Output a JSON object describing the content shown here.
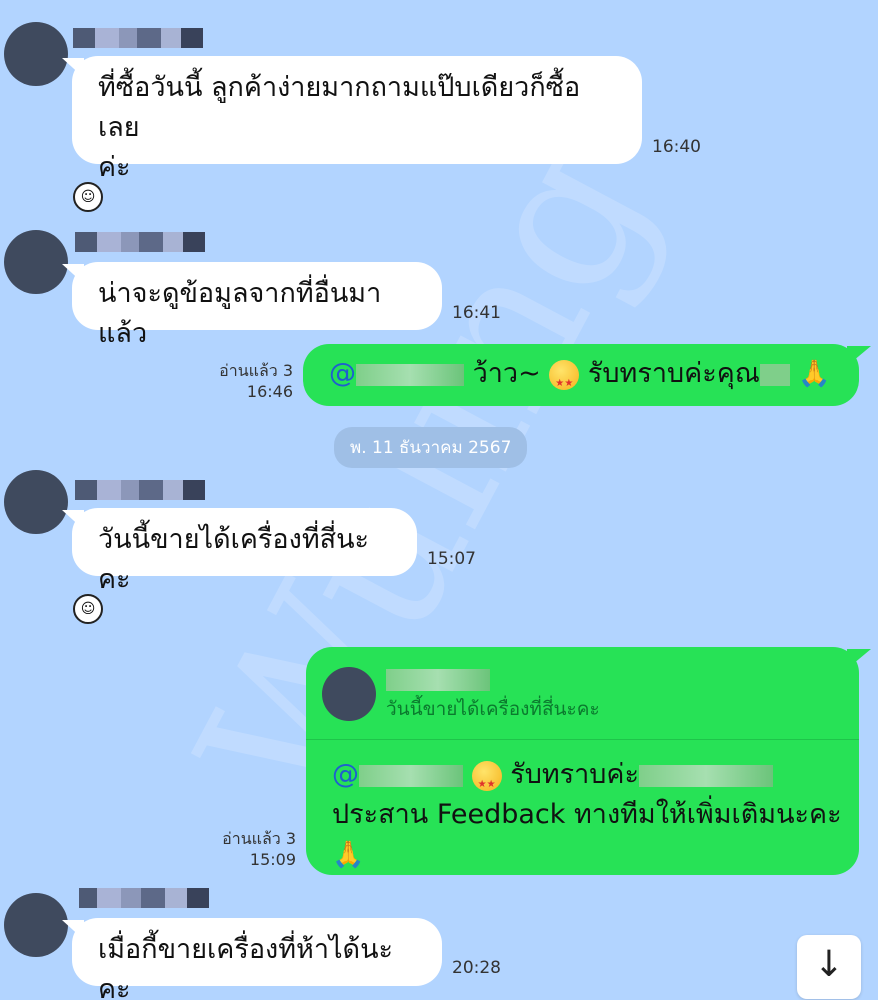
{
  "watermark": "Wuling",
  "colors": {
    "background": "#b2d4ff",
    "incoming_bubble": "#ffffff",
    "outgoing_bubble": "#27e256",
    "mention": "#1f5fcf"
  },
  "messages": [
    {
      "text_line1": "ที่ซื้อวันนี้ ลูกค้าง่ายมากถามแป๊บเดียวก็ซื้อเลย",
      "text_line2": "ค่ะ",
      "time": "16:40"
    },
    {
      "text": "น่าจะดูข้อมูลจากที่อื่นมาแล้ว",
      "time": "16:41"
    },
    {
      "read": "อ่านแล้ว 3",
      "time": "16:46",
      "mention": "@",
      "text_a": "ว้าว~",
      "text_b": "รับทราบค่ะคุณ",
      "pray": "🙏"
    },
    {
      "text": "วันนี้ขายได้เครื่องที่สี่นะคะ",
      "time": "15:07"
    },
    {
      "read": "อ่านแล้ว 3",
      "time": "15:09",
      "reply_quote": "วันนี้ขายได้เครื่องที่สี่นะคะ",
      "mention": "@",
      "text_a": "รับทราบค่ะ",
      "text_line2": "ประสาน Feedback ทางทีมให้เพิ่มเติมนะคะ",
      "pray": "🙏"
    },
    {
      "text": "เมื่อกี้ขายเครื่องที่ห้าได้นะคะ",
      "time": "20:28"
    }
  ],
  "date_separator": "พ. 11 ธันวาคม 2567",
  "scroll_button_icon": "arrow-down-icon",
  "scroll_button_glyph": "↓",
  "sticker_glyph": "☺"
}
